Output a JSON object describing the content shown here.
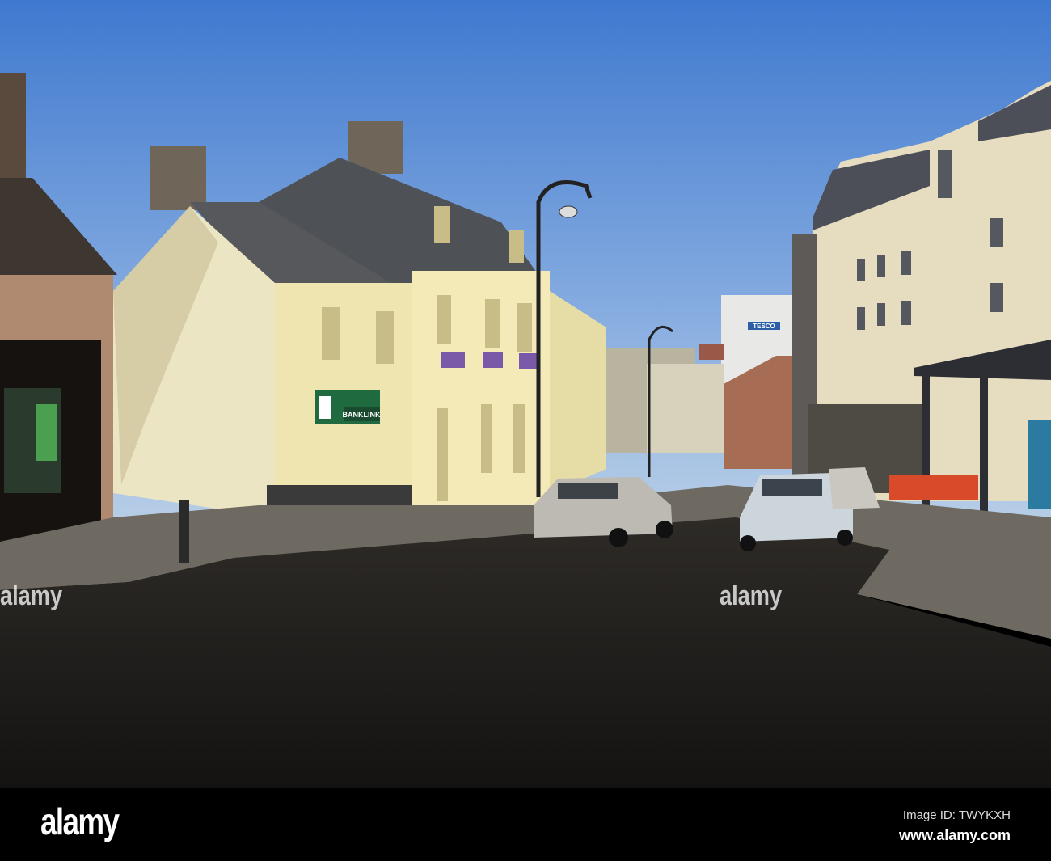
{
  "photo": {
    "signs": {
      "bank": "BANKLINK",
      "supermarket": "TESCO"
    },
    "colors": {
      "sky_top": "#3f79cf",
      "sky_bottom": "#a9c6e6",
      "road": "#1f1d1a",
      "facade": "#efe7b8",
      "bank_green": "#1f6b3f"
    }
  },
  "watermark": {
    "text": "alamy"
  },
  "footer": {
    "logo": "alamy",
    "image_id": "Image ID: TWYKXH",
    "website": "www.alamy.com"
  }
}
